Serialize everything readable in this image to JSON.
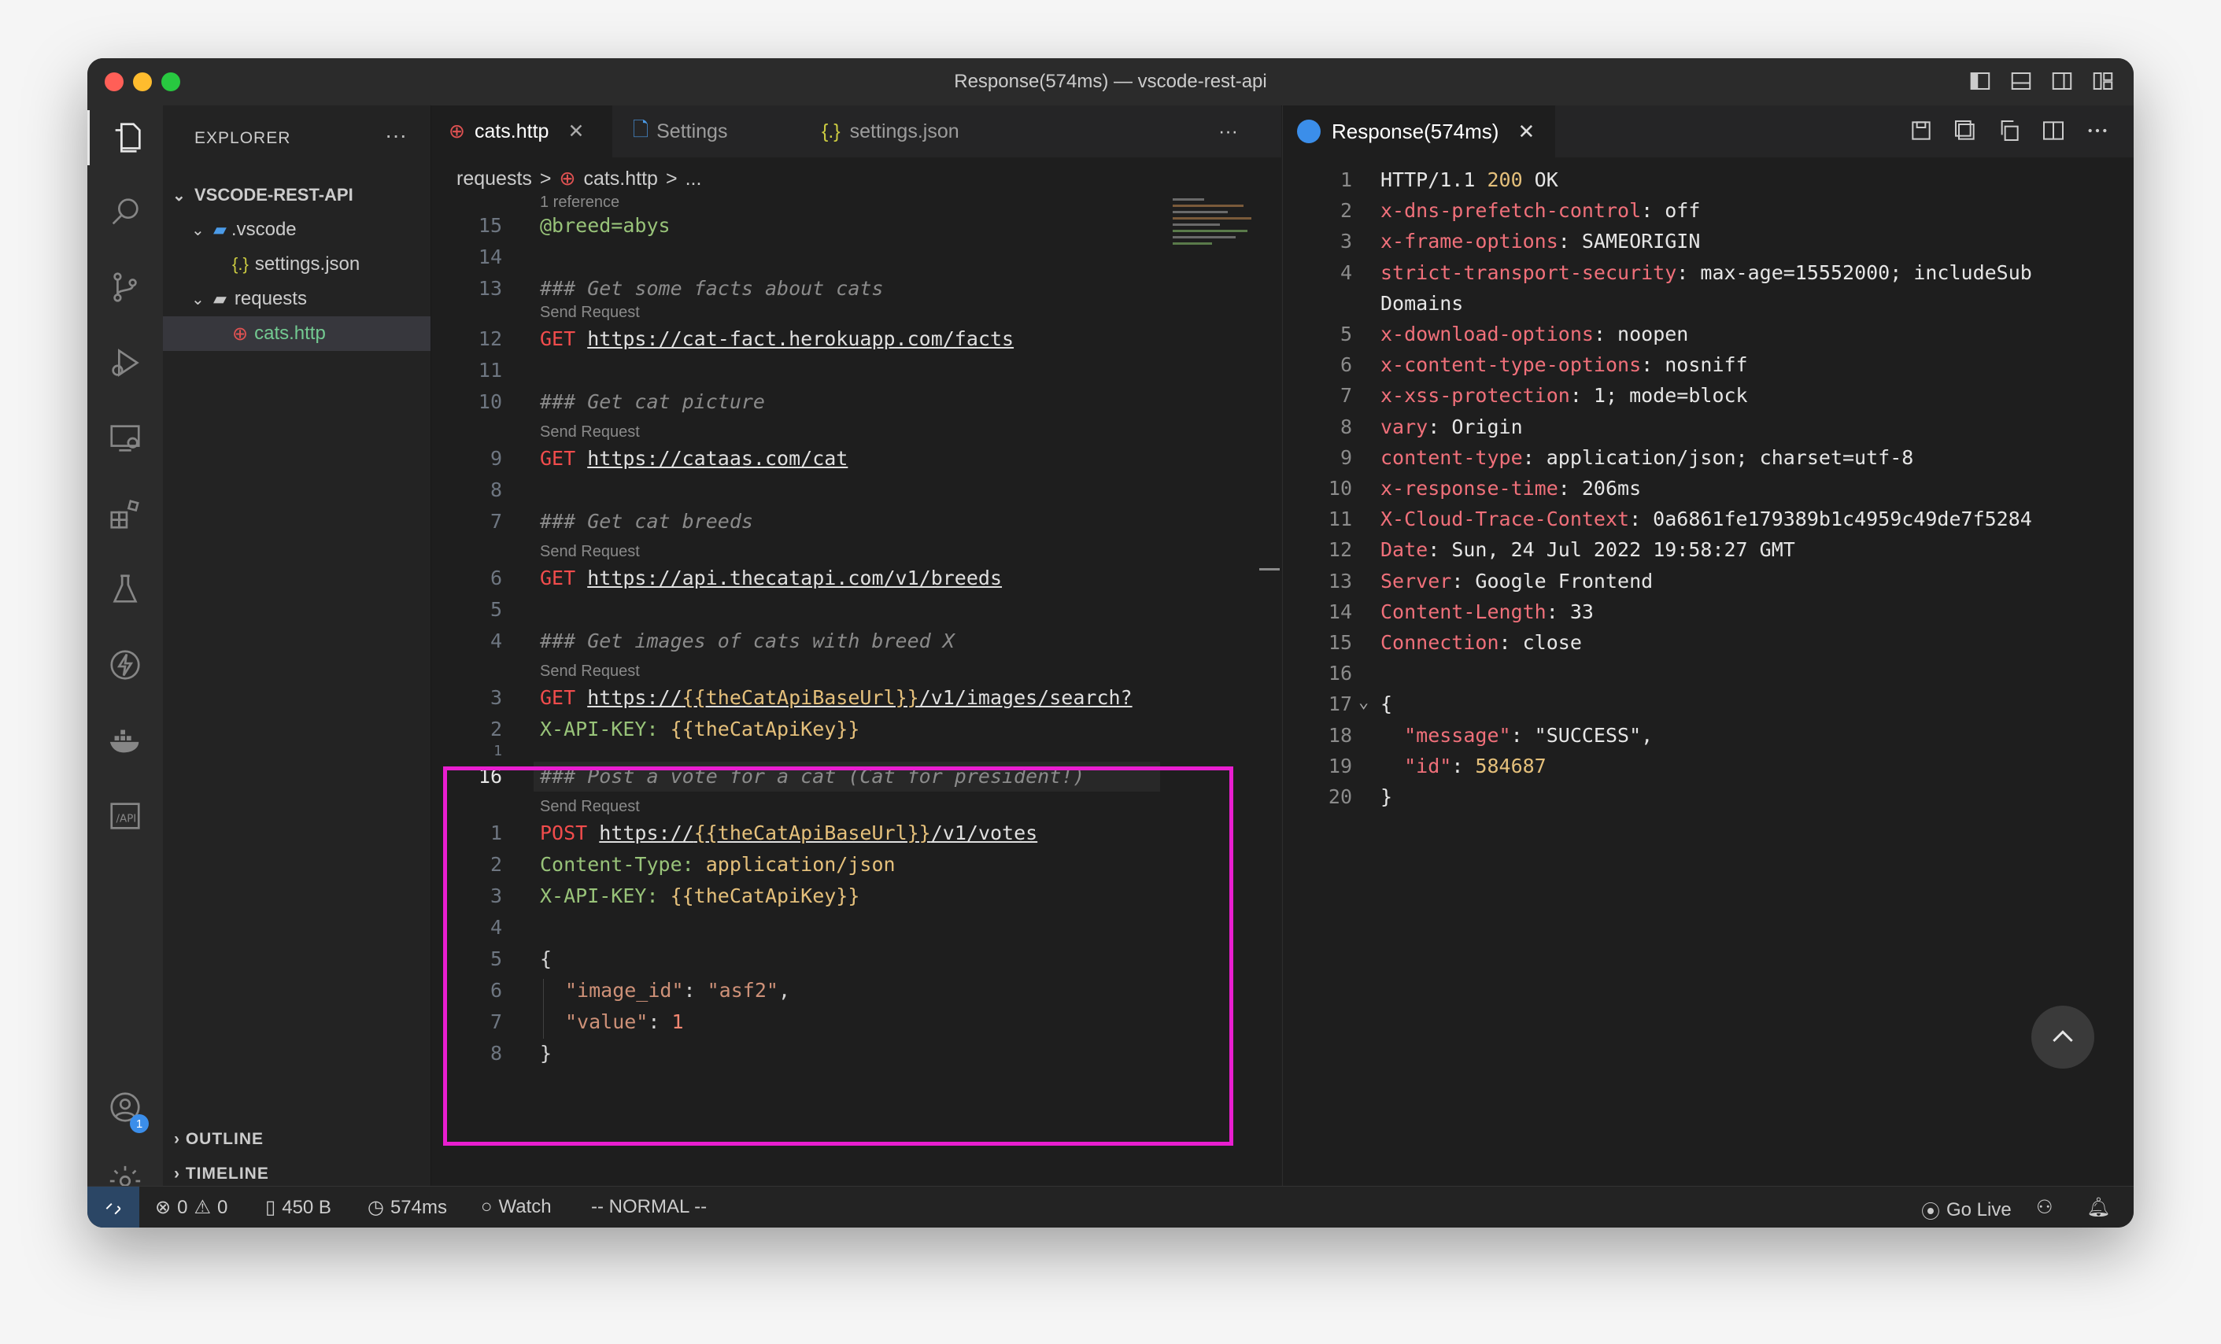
{
  "window": {
    "title": "Response(574ms) — vscode-rest-api"
  },
  "sidebar": {
    "header": "EXPLORER",
    "more": "···",
    "project": "VSCODE-REST-API",
    "items": [
      {
        "label": ".vscode"
      },
      {
        "label": "settings.json"
      },
      {
        "label": "requests"
      },
      {
        "label": "cats.http"
      }
    ],
    "outline": "OUTLINE",
    "timeline": "TIMELINE"
  },
  "editor": {
    "tabs": [
      {
        "label": "cats.http"
      },
      {
        "label": "Settings"
      },
      {
        "label": "settings.json"
      }
    ],
    "tab_more": "···",
    "breadcrumb": [
      "requests",
      ">",
      "cats.http",
      ">",
      "..."
    ],
    "codelens_reference": "1 reference",
    "send_request": "Send Request",
    "lines": {
      "l15_num": "15",
      "l15": "@breed=abys",
      "l14_num": "14",
      "l13_num": "13",
      "l13": "### Get some facts about cats",
      "l12_num": "12",
      "l12_method": "GET",
      "l12_url": "https://cat-fact.herokuapp.com/facts",
      "l11_num": "11",
      "l10_num": "10",
      "l10": "### Get cat picture",
      "l9_num": "9",
      "l9_method": "GET",
      "l9_url": "https://cataas.com/cat",
      "l8_num": "8",
      "l7_num": "7",
      "l7": "### Get cat breeds",
      "l6_num": "6",
      "l6_method": "GET",
      "l6_url": "https://api.thecatapi.com/v1/breeds",
      "l5_num": "5",
      "l4_num": "4",
      "l4": "### Get images of cats with breed X",
      "l3_num": "3",
      "l3_method": "GET",
      "l3_url_a": "https://",
      "l3_var": "{{theCatApiBaseUrl}}",
      "l3_url_b": "/v1/images/search?",
      "l2_num": "2",
      "l2_hdr": "X-API-KEY:",
      "l2_var": "{{theCatApiKey}}",
      "l1a_num": "1",
      "cur_num": "16",
      "cur": "### Post a vote for a cat (Cat for president!)",
      "p1_num": "1",
      "p1_method": "POST",
      "p1_url_a": "https://",
      "p1_var": "{{theCatApiBaseUrl}}",
      "p1_url_b": "/v1/votes",
      "p2_num": "2",
      "p2_hdr": "Content-Type:",
      "p2_val": "application/json",
      "p3_num": "3",
      "p3_hdr": "X-API-KEY:",
      "p3_var": "{{theCatApiKey}}",
      "p4_num": "4",
      "p5_num": "5",
      "p5": "{",
      "p6_num": "6",
      "p6_key": "\"image_id\"",
      "p6_colon": ": ",
      "p6_val": "\"asf2\"",
      "p6_comma": ",",
      "p7_num": "7",
      "p7_key": "\"value\"",
      "p7_colon": ": ",
      "p7_val": "1",
      "p8_num": "8",
      "p8": "}"
    }
  },
  "response": {
    "tab_label": "Response(574ms)",
    "lines": [
      {
        "n": "1",
        "k": "",
        "v": "HTTP/1.1 ",
        "num": "200",
        "rest": " OK"
      },
      {
        "n": "2",
        "k": "x-dns-prefetch-control",
        "v": ": off"
      },
      {
        "n": "3",
        "k": "x-frame-options",
        "v": ": SAMEORIGIN"
      },
      {
        "n": "4",
        "k": "strict-transport-security",
        "v": ": max-age=15552000; includeSub"
      },
      {
        "n": "",
        "k": "",
        "v": "Domains"
      },
      {
        "n": "5",
        "k": "x-download-options",
        "v": ": noopen"
      },
      {
        "n": "6",
        "k": "x-content-type-options",
        "v": ": nosniff"
      },
      {
        "n": "7",
        "k": "x-xss-protection",
        "v": ": 1; mode=block"
      },
      {
        "n": "8",
        "k": "vary",
        "v": ": Origin"
      },
      {
        "n": "9",
        "k": "content-type",
        "v": ": application/json; charset=utf-8"
      },
      {
        "n": "10",
        "k": "x-response-time",
        "v": ": 206ms"
      },
      {
        "n": "11",
        "k": "X-Cloud-Trace-Context",
        "v": ": 0a6861fe179389b1c4959c49de7f5284"
      },
      {
        "n": "12",
        "k": "Date",
        "v": ": Sun, 24 Jul 2022 19:58:27 GMT"
      },
      {
        "n": "13",
        "k": "Server",
        "v": ": Google Frontend"
      },
      {
        "n": "14",
        "k": "Content-Length",
        "v": ": 33"
      },
      {
        "n": "15",
        "k": "Connection",
        "v": ": close"
      },
      {
        "n": "16",
        "k": "",
        "v": ""
      },
      {
        "n": "17",
        "k": "",
        "v": "{"
      },
      {
        "n": "18",
        "k": "  \"message\"",
        "v": ": \"SUCCESS\","
      },
      {
        "n": "19",
        "k": "  \"id\"",
        "v": ": ",
        "num": "584687"
      },
      {
        "n": "20",
        "k": "",
        "v": "}"
      }
    ]
  },
  "statusbar": {
    "errors": "0",
    "warnings": "0",
    "size": "450 B",
    "time": "574ms",
    "watch": "Watch",
    "mode": "-- NORMAL --",
    "golive": "Go Live"
  },
  "activity": {
    "accounts_badge": "1"
  },
  "colors": {
    "highlight": "#e91ed0",
    "accent": "#3b8eea"
  }
}
